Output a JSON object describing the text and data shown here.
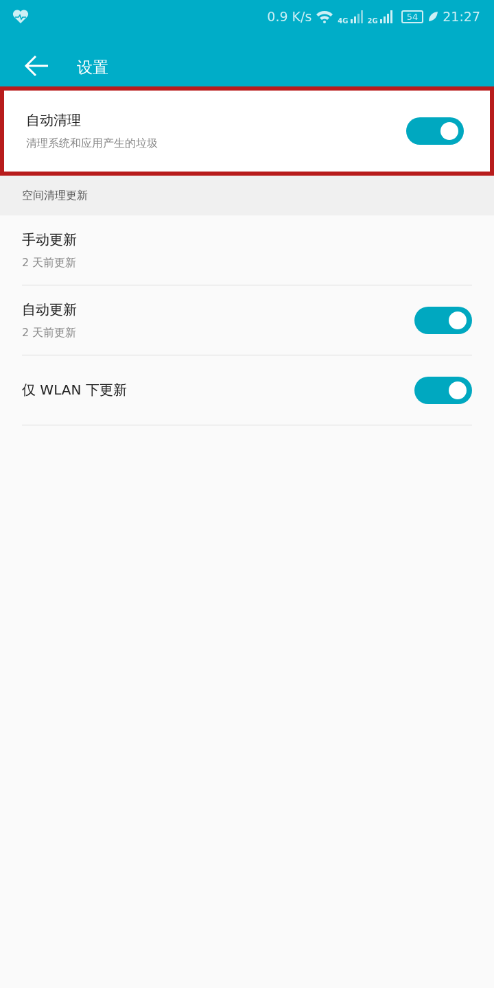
{
  "status_bar": {
    "speed": "0.9 K/s",
    "net_1": "4G",
    "net_2": "2G",
    "battery": "54",
    "time": "21:27"
  },
  "app_bar": {
    "title": "设置"
  },
  "sections": [
    {
      "items": [
        {
          "kind": "switch",
          "title": "自动清理",
          "subtitle": "清理系统和应用产生的垃圾",
          "on": true,
          "highlighted": true
        }
      ]
    },
    {
      "header": "空间清理更新",
      "items": [
        {
          "kind": "link",
          "title": "手动更新",
          "subtitle": "2 天前更新",
          "highlighted": false
        },
        {
          "kind": "switch",
          "title": "自动更新",
          "subtitle": "2 天前更新",
          "on": true,
          "highlighted": false
        },
        {
          "kind": "switch",
          "title": "仅 WLAN 下更新",
          "on": true,
          "highlighted": false
        }
      ]
    }
  ]
}
